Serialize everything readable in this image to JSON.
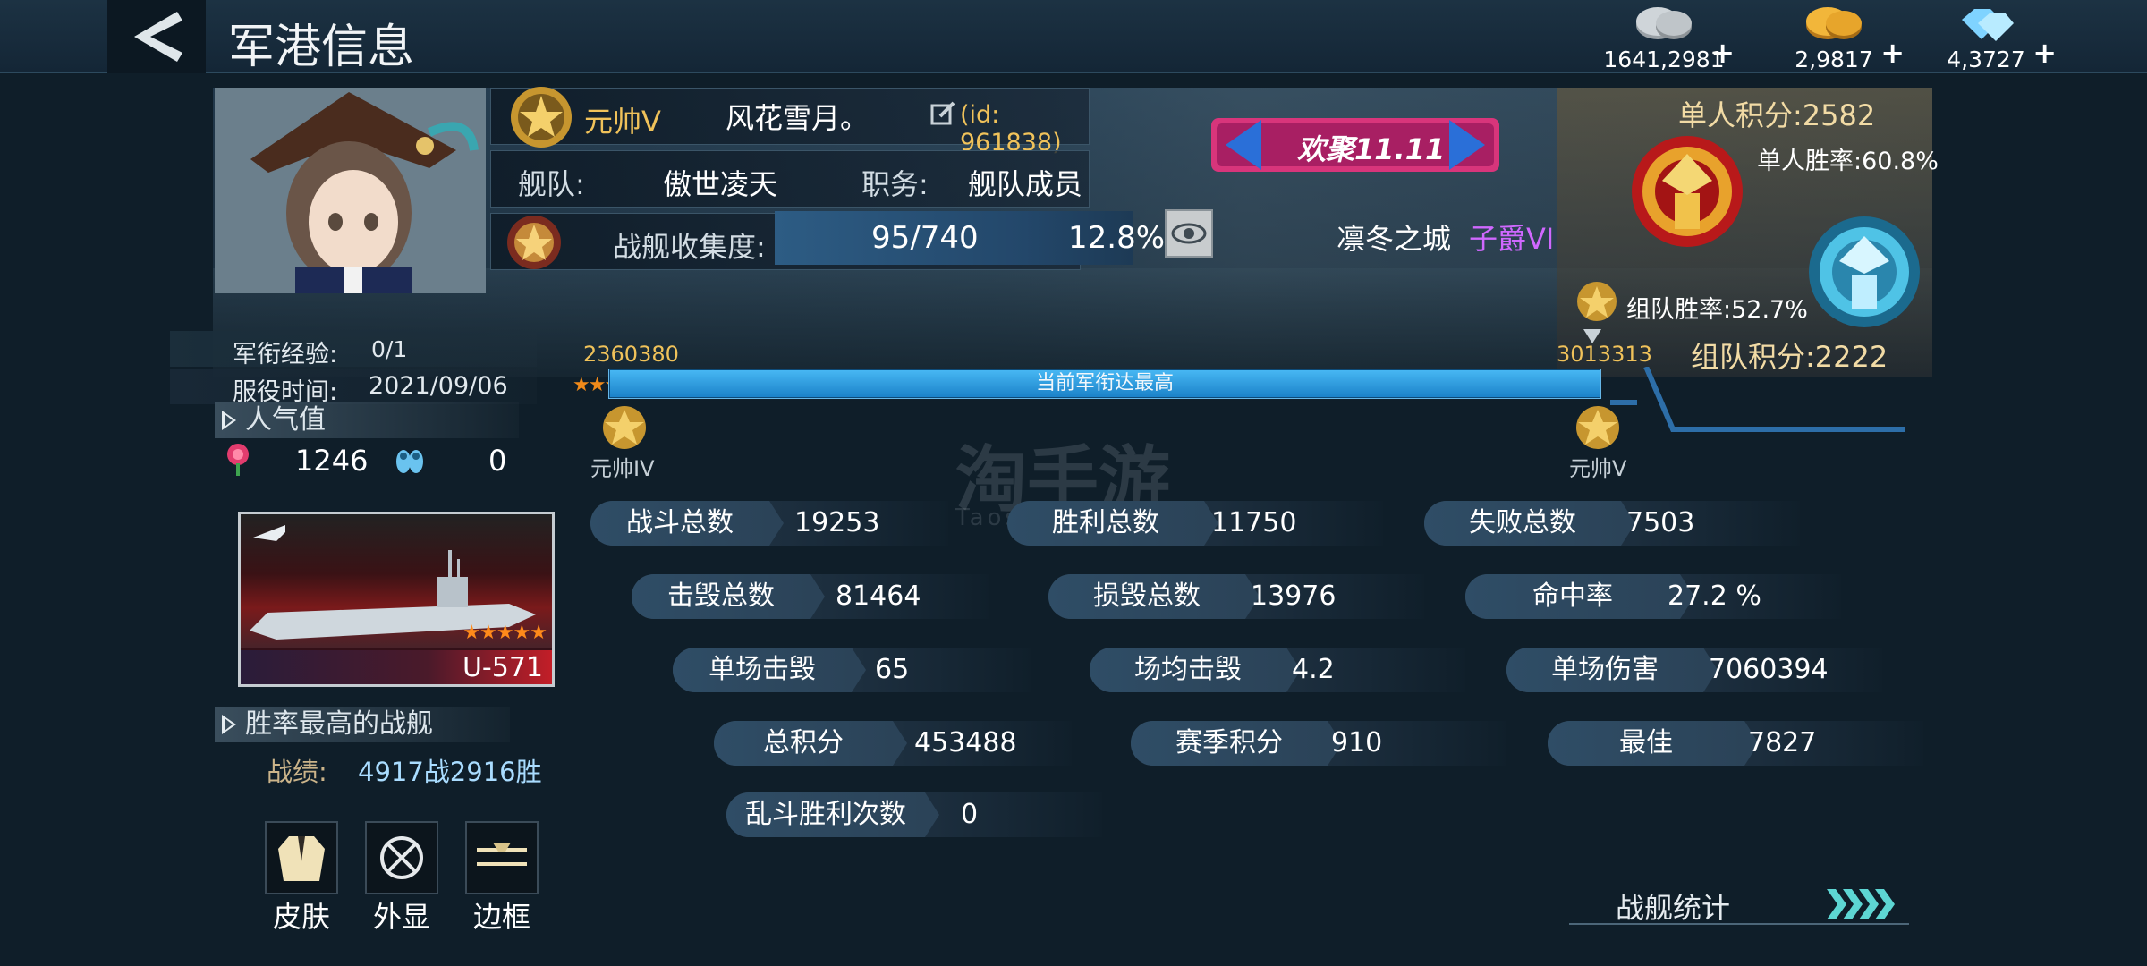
{
  "header": {
    "title": "军港信息"
  },
  "currencies": [
    {
      "name": "silver-coin-icon",
      "value": "1641,2981",
      "color": "#c9cfd4"
    },
    {
      "name": "gold-coin-icon",
      "value": "2,9817",
      "color": "#f2b63a"
    },
    {
      "name": "diamond-icon",
      "value": "4,3727",
      "color": "#7fd3ff"
    }
  ],
  "profile": {
    "rank_title": "元帅V",
    "player_name": "风花雪月。",
    "player_id": "(id: 961838)",
    "fleet_label": "舰队:",
    "fleet_name": "傲世凌天",
    "position_label": "职务:",
    "position_value": "舰队成员",
    "collection_label": "战舰收集度:",
    "collection_value": "95/740",
    "collection_percent": "12.8%",
    "city": "凛冬之城",
    "noble_rank": "子爵VI"
  },
  "event_banner": {
    "text": "欢聚11.11"
  },
  "ranked": {
    "solo_score": "单人积分:2582",
    "solo_winrate": "单人胜率:60.8%",
    "team_winrate": "组队胜率:52.7%",
    "team_score": "组队积分:2222"
  },
  "military": {
    "exp_label": "军衔经验:",
    "exp_value": "0/1",
    "service_label": "服役时间:",
    "service_value": "2021/09/06",
    "progress_left": "2360380",
    "progress_right": "3013313",
    "progress_text": "当前军衔达最高",
    "progress_fraction": 1.0,
    "rank_left": "元帅IV",
    "rank_right": "元帅V"
  },
  "popularity": {
    "title": "人气值",
    "likes": "1246",
    "slippers": "0"
  },
  "ship": {
    "name": "U-571",
    "stars": 5
  },
  "best_ship": {
    "title": "胜率最高的战舰",
    "record_label": "战绩:",
    "record_value": "4917战2916胜"
  },
  "buttons": {
    "skin": "皮肤",
    "display": "外显",
    "frame": "边框",
    "ship_stats": "战舰统计"
  },
  "stats": [
    {
      "label": "战斗总数",
      "value": "19253"
    },
    {
      "label": "胜利总数",
      "value": "11750"
    },
    {
      "label": "失败总数",
      "value": "7503"
    },
    {
      "label": "击毁总数",
      "value": "81464"
    },
    {
      "label": "损毁总数",
      "value": "13976"
    },
    {
      "label": "命中率",
      "value": "27.2 %"
    },
    {
      "label": "单场击毁",
      "value": "65"
    },
    {
      "label": "场均击毁",
      "value": "4.2"
    },
    {
      "label": "单场伤害",
      "value": "7060394"
    },
    {
      "label": "总积分",
      "value": "453488"
    },
    {
      "label": "赛季积分",
      "value": "910"
    },
    {
      "label": "最佳",
      "value": "7827"
    },
    {
      "label": "乱斗胜利次数",
      "value": "0"
    }
  ],
  "watermark": {
    "main": "淘手游",
    "sub": "Taoshouyou.com"
  }
}
